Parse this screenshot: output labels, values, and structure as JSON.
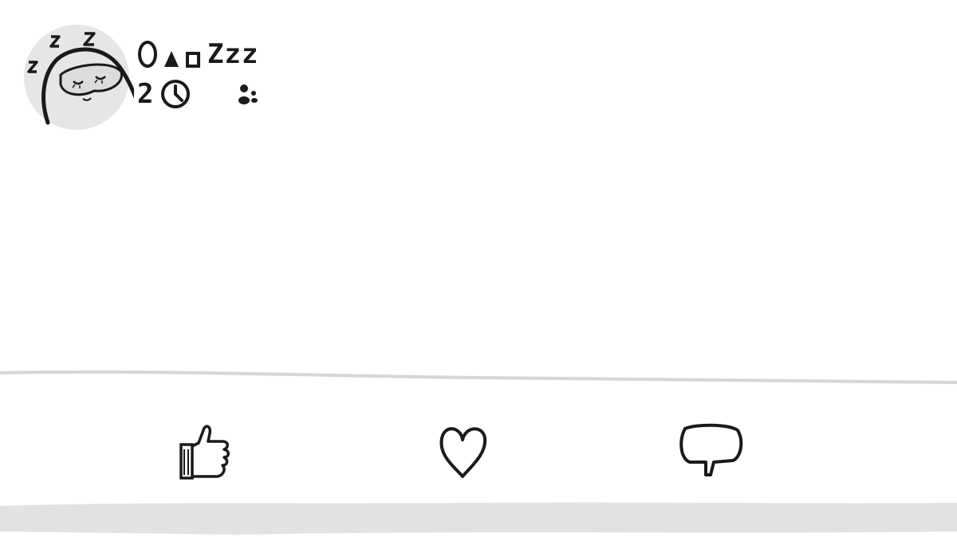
{
  "post": {
    "author": {
      "name_text": "Zzz",
      "avatar_icon": "sleeping-face-icon"
    },
    "timestamp": {
      "value": "2",
      "icon": "clock-icon",
      "audience_icon": "friends-icon"
    }
  },
  "actions": [
    {
      "name": "like",
      "icon": "thumbs-up-icon"
    },
    {
      "name": "love",
      "icon": "heart-icon"
    },
    {
      "name": "comment",
      "icon": "speech-bubble-icon"
    }
  ],
  "colors": {
    "ink": "#1a1a1a",
    "avatar_bg": "#e6e6e6",
    "divider": "#d6d6d6",
    "band": "#e2e2e2"
  }
}
